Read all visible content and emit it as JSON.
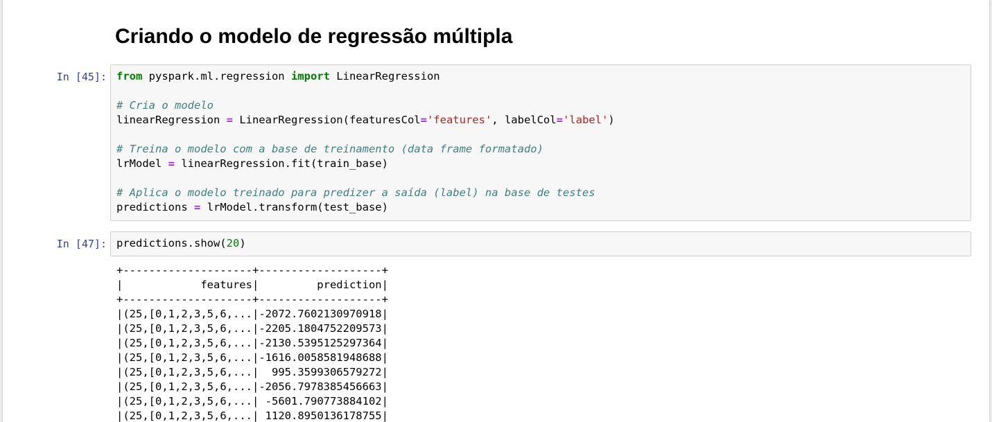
{
  "section_heading": "Criando o modelo de regressão múltipla",
  "cells": [
    {
      "prompt": "In [45]:",
      "lines": [
        [
          {
            "t": "from",
            "c": "kw"
          },
          {
            "t": " pyspark.ml.regression ",
            "c": ""
          },
          {
            "t": "import",
            "c": "kw"
          },
          {
            "t": " LinearRegression",
            "c": ""
          }
        ],
        [],
        [
          {
            "t": "# Cria o modelo",
            "c": "cm"
          }
        ],
        [
          {
            "t": "linearRegression ",
            "c": ""
          },
          {
            "t": "=",
            "c": "op"
          },
          {
            "t": " LinearRegression(featuresCol",
            "c": ""
          },
          {
            "t": "=",
            "c": "op"
          },
          {
            "t": "'features'",
            "c": "str"
          },
          {
            "t": ", labelCol",
            "c": ""
          },
          {
            "t": "=",
            "c": "op"
          },
          {
            "t": "'label'",
            "c": "str"
          },
          {
            "t": ")",
            "c": ""
          }
        ],
        [],
        [
          {
            "t": "# Treina o modelo com a base de treinamento (data frame formatado)",
            "c": "cm"
          }
        ],
        [
          {
            "t": "lrModel ",
            "c": ""
          },
          {
            "t": "=",
            "c": "op"
          },
          {
            "t": " linearRegression.fit(train_base)",
            "c": ""
          }
        ],
        [],
        [
          {
            "t": "# Aplica o modelo treinado para predizer a saída (label) na base de testes",
            "c": "cm"
          }
        ],
        [
          {
            "t": "predictions ",
            "c": ""
          },
          {
            "t": "=",
            "c": "op"
          },
          {
            "t": " lrModel.transform(test_base)",
            "c": ""
          }
        ]
      ]
    },
    {
      "prompt": "In [47]:",
      "lines": [
        [
          {
            "t": "predictions.show(",
            "c": ""
          },
          {
            "t": "20",
            "c": "num"
          },
          {
            "t": ")",
            "c": ""
          }
        ]
      ]
    }
  ],
  "output": {
    "border": "+--------------------+-------------------+",
    "header": "|            features|         prediction|",
    "rows": [
      {
        "features": "(25,[0,1,2,3,5,6,...",
        "prediction": "-2072.7602130970918"
      },
      {
        "features": "(25,[0,1,2,3,5,6,...",
        "prediction": "-2205.1804752209573"
      },
      {
        "features": "(25,[0,1,2,3,5,6,...",
        "prediction": "-2130.5395125297364"
      },
      {
        "features": "(25,[0,1,2,3,5,6,...",
        "prediction": "-1616.0058581948688"
      },
      {
        "features": "(25,[0,1,2,3,5,6,...",
        "prediction": "995.3599306579272"
      },
      {
        "features": "(25,[0,1,2,3,5,6,...",
        "prediction": "-2056.7978385456663"
      },
      {
        "features": "(25,[0,1,2,3,5,6,...",
        "prediction": "-5601.790773884102"
      },
      {
        "features": "(25,[0,1,2,3,5,6,...",
        "prediction": "1120.8950136178755"
      }
    ]
  }
}
